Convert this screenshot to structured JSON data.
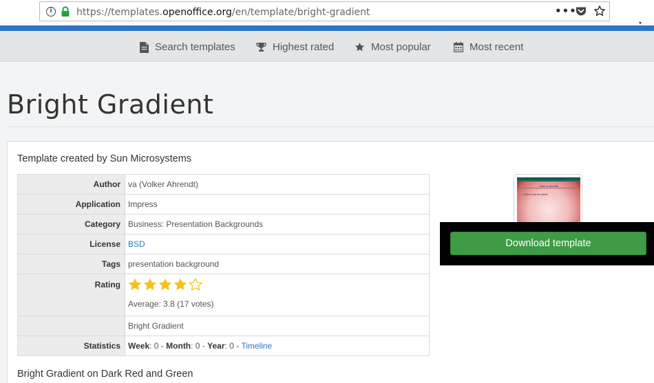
{
  "browser": {
    "url_prefix": "https://templates.",
    "url_host": "openoffice.org",
    "url_path": "/en/template/bright-gradient",
    "menu_icon": "more-dots-icon",
    "pocket_icon": "pocket-icon",
    "bookmark_icon": "star-icon"
  },
  "nav": {
    "items": [
      {
        "label": "Search templates",
        "icon": "document-icon"
      },
      {
        "label": "Highest rated",
        "icon": "trophy-icon"
      },
      {
        "label": "Most popular",
        "icon": "star-icon"
      },
      {
        "label": "Most recent",
        "icon": "calendar-icon"
      }
    ]
  },
  "page": {
    "title": "Bright Gradient",
    "created_by": "Template created by Sun Microsystems",
    "description": "Bright Gradient on Dark Red and Green"
  },
  "details": {
    "author_label": "Author",
    "author_value": "va (Volker Ahrendt)",
    "application_label": "Application",
    "application_value": "Impress",
    "category_label": "Category",
    "category_value": "Business: Presentation Backgrounds",
    "license_label": "License",
    "license_value": "BSD",
    "tags_label": "Tags",
    "tags_value": "presentation background",
    "rating_label": "Rating",
    "rating_stars": 4,
    "rating_max": 5,
    "rating_average": "Average: 3.8 (17 votes)",
    "title_value": "Bright Gradient",
    "statistics_label": "Statistics",
    "week_label": "Week",
    "week_value": ": 0 - ",
    "month_label": "Month",
    "month_value": ": 0 - ",
    "year_label": "Year",
    "year_value": ": 0 - ",
    "timeline_link": "Timeline"
  },
  "preview": {
    "slide_title": "Click to add title",
    "slide_outline": "• Click to add an outline"
  },
  "download": {
    "label": "Download template"
  },
  "colors": {
    "accent_blue": "#2d75c4",
    "download_green": "#3f9b45",
    "star_gold": "#f6c21a"
  }
}
